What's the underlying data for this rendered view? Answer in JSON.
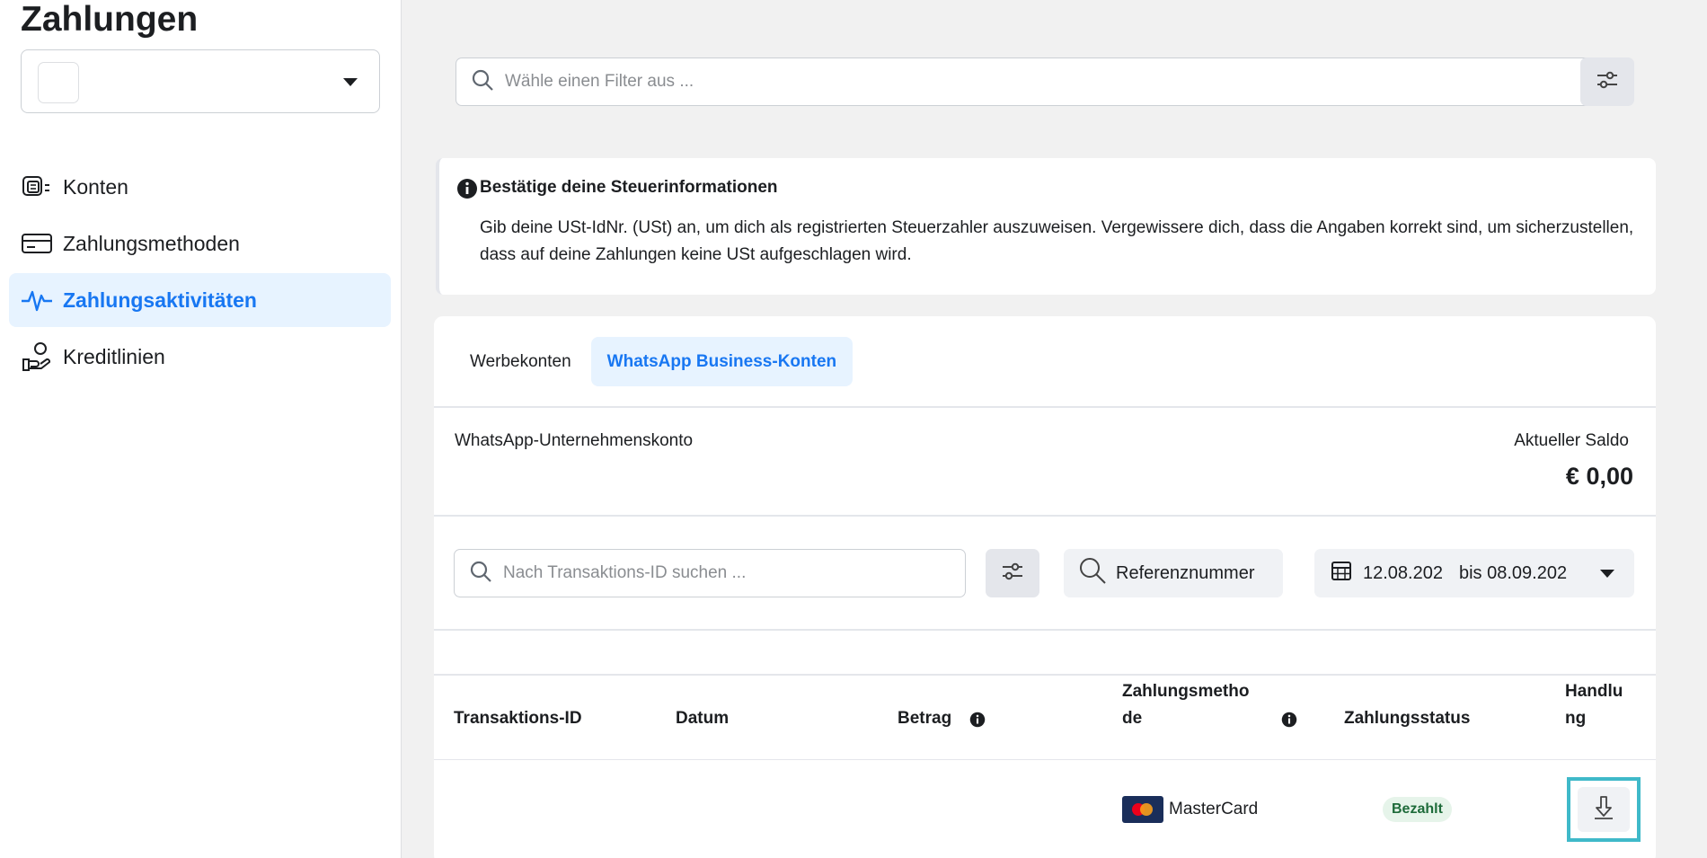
{
  "page": {
    "title": "Zahlungen"
  },
  "sidebar": {
    "items": [
      {
        "label": "Konten",
        "icon": "accounts-icon"
      },
      {
        "label": "Zahlungsmethoden",
        "icon": "credit-card-icon"
      },
      {
        "label": "Zahlungsaktivitäten",
        "icon": "activity-icon",
        "active": true
      },
      {
        "label": "Kreditlinien",
        "icon": "credit-line-icon"
      }
    ]
  },
  "filter": {
    "placeholder": "Wähle einen Filter aus ..."
  },
  "notice": {
    "title": "Bestätige deine Steuerinformationen",
    "body": "Gib deine USt-IdNr. (USt) an, um dich als registrierten Steuerzahler auszuweisen. Vergewissere dich, dass die Angaben korrekt sind, um sicherzustellen, dass auf deine Zahlungen keine USt aufgeschlagen wird."
  },
  "tabs": [
    {
      "label": "Werbekonten"
    },
    {
      "label": "WhatsApp Business-Konten",
      "active": true
    }
  ],
  "account": {
    "label": "WhatsApp-Unternehmenskonto",
    "balance_label": "Aktueller Saldo",
    "balance_value": "€ 0,00"
  },
  "transactions": {
    "search_placeholder": "Nach Transaktions-ID suchen ...",
    "reference_label": "Referenznummer",
    "date_from": "12.08.202",
    "date_to": "bis 08.09.202",
    "columns": {
      "id": "Transaktions-ID",
      "date": "Datum",
      "amount": "Betrag",
      "method_line1": "Zahlungsmetho",
      "method_line2": "de",
      "status": "Zahlungsstatus",
      "action_line1": "Handlu",
      "action_line2": "ng"
    },
    "rows": [
      {
        "id": "",
        "date": "",
        "amount": "",
        "method": "MasterCard",
        "status": "Bezahlt"
      }
    ]
  },
  "colors": {
    "accent": "#1877f2",
    "active_bg": "#e7f3ff",
    "paid_badge_bg": "#e6f4ea",
    "highlight": "#3fb9c9"
  }
}
